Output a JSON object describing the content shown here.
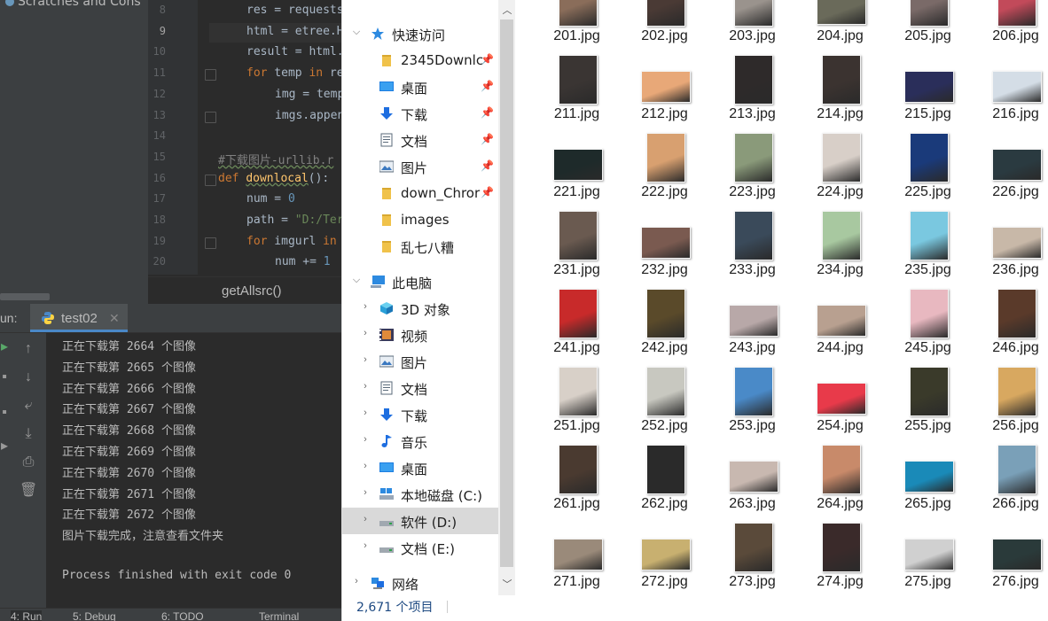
{
  "ide": {
    "project_title": "Scratches and Cons",
    "line_numbers": [
      "8",
      "9",
      "10",
      "11",
      "12",
      "13",
      "14",
      "15",
      "16",
      "17",
      "18",
      "19",
      "20"
    ],
    "current_line": "9",
    "code_lines": [
      {
        "indent": 1,
        "parts": [
          {
            "t": "res = requests",
            "c": ""
          }
        ]
      },
      {
        "indent": 1,
        "parts": [
          {
            "t": "html = ",
            "c": ""
          },
          {
            "t": "etree.H",
            "c": ""
          }
        ]
      },
      {
        "indent": 1,
        "parts": [
          {
            "t": "result = html.",
            "c": ""
          }
        ]
      },
      {
        "indent": 1,
        "parts": [
          {
            "t": "for",
            "c": "kw"
          },
          {
            "t": " temp ",
            "c": ""
          },
          {
            "t": "in",
            "c": "kw"
          },
          {
            "t": " re",
            "c": ""
          }
        ]
      },
      {
        "indent": 2,
        "parts": [
          {
            "t": "img = temp",
            "c": ""
          }
        ]
      },
      {
        "indent": 2,
        "parts": [
          {
            "t": "imgs.appen",
            "c": ""
          }
        ]
      },
      {
        "indent": 0,
        "parts": []
      },
      {
        "indent": 0,
        "parts": [
          {
            "t": "#下载图片-urllib.r",
            "c": "cm"
          }
        ]
      },
      {
        "indent": 0,
        "parts": [
          {
            "t": "def",
            "c": "kw"
          },
          {
            "t": " ",
            "c": ""
          },
          {
            "t": "downlocal",
            "c": "fn"
          },
          {
            "t": "():",
            "c": ""
          }
        ]
      },
      {
        "indent": 1,
        "parts": [
          {
            "t": "num = ",
            "c": ""
          },
          {
            "t": "0",
            "c": "num"
          }
        ]
      },
      {
        "indent": 1,
        "parts": [
          {
            "t": "path = ",
            "c": ""
          },
          {
            "t": "\"D:/Ter",
            "c": "str"
          }
        ]
      },
      {
        "indent": 1,
        "parts": [
          {
            "t": "for",
            "c": "kw"
          },
          {
            "t": " imgurl ",
            "c": ""
          },
          {
            "t": "in",
            "c": "kw"
          }
        ]
      },
      {
        "indent": 2,
        "parts": [
          {
            "t": "num += ",
            "c": ""
          },
          {
            "t": "1",
            "c": "num"
          }
        ]
      }
    ],
    "breadcrumb": "getAllsrc()",
    "run_label": "un:",
    "run_tab": "test02",
    "console_lines": [
      "正在下载第 2664 个图像",
      "正在下载第 2665 个图像",
      "正在下载第 2666 个图像",
      "正在下载第 2667 个图像",
      "正在下载第 2668 个图像",
      "正在下载第 2669 个图像",
      "正在下载第 2670 个图像",
      "正在下载第 2671 个图像",
      "正在下载第 2672 个图像",
      "图片下载完成，注意查看文件夹",
      "",
      "Process finished with exit code 0"
    ],
    "bottom_tabs": [
      "4: Run",
      "5: Debug",
      "6: TODO",
      "Terminal"
    ]
  },
  "explorer": {
    "nav_items": [
      {
        "label": "快速访问",
        "icon": "star-icon",
        "level": 0,
        "chevron": "down",
        "pinned": false
      },
      {
        "label": "2345Downlc",
        "icon": "folder-icon",
        "level": 1,
        "chevron": "",
        "pinned": true
      },
      {
        "label": "桌面",
        "icon": "desktop-icon",
        "level": 1,
        "chevron": "",
        "pinned": true
      },
      {
        "label": "下载",
        "icon": "download-icon",
        "level": 1,
        "chevron": "",
        "pinned": true
      },
      {
        "label": "文档",
        "icon": "document-icon",
        "level": 1,
        "chevron": "",
        "pinned": true
      },
      {
        "label": "图片",
        "icon": "picture-icon",
        "level": 1,
        "chevron": "",
        "pinned": true
      },
      {
        "label": "down_Chror",
        "icon": "folder-icon",
        "level": 1,
        "chevron": "",
        "pinned": true
      },
      {
        "label": "images",
        "icon": "folder-icon",
        "level": 1,
        "chevron": "",
        "pinned": false
      },
      {
        "label": "乱七八糟",
        "icon": "folder-icon",
        "level": 1,
        "chevron": "",
        "pinned": false
      },
      {
        "label": "此电脑",
        "icon": "computer-icon",
        "level": 0,
        "chevron": "down",
        "pinned": false
      },
      {
        "label": "3D 对象",
        "icon": "cube-icon",
        "level": 1,
        "chevron": "right",
        "pinned": false
      },
      {
        "label": "视频",
        "icon": "video-icon",
        "level": 1,
        "chevron": "right",
        "pinned": false
      },
      {
        "label": "图片",
        "icon": "picture-icon",
        "level": 1,
        "chevron": "right",
        "pinned": false
      },
      {
        "label": "文档",
        "icon": "document-icon",
        "level": 1,
        "chevron": "right",
        "pinned": false
      },
      {
        "label": "下载",
        "icon": "download-icon",
        "level": 1,
        "chevron": "right",
        "pinned": false
      },
      {
        "label": "音乐",
        "icon": "music-icon",
        "level": 1,
        "chevron": "right",
        "pinned": false
      },
      {
        "label": "桌面",
        "icon": "desktop-icon",
        "level": 1,
        "chevron": "right",
        "pinned": false
      },
      {
        "label": "本地磁盘 (C:)",
        "icon": "drive-c-icon",
        "level": 1,
        "chevron": "right",
        "pinned": false
      },
      {
        "label": "软件 (D:)",
        "icon": "drive-icon",
        "level": 1,
        "chevron": "right",
        "pinned": false,
        "selected": true
      },
      {
        "label": "文档 (E:)",
        "icon": "drive-icon",
        "level": 1,
        "chevron": "right",
        "pinned": false
      },
      {
        "label": "网络",
        "icon": "network-icon",
        "level": 0,
        "chevron": "right",
        "pinned": false
      }
    ],
    "status": "2,671 个项目",
    "files": [
      {
        "name": "201.jpg",
        "color": "#8a6d5a"
      },
      {
        "name": "202.jpg",
        "color": "#4a3a35"
      },
      {
        "name": "203.jpg",
        "color": "#9a938d"
      },
      {
        "name": "204.jpg",
        "color": "#6a6a5a"
      },
      {
        "name": "205.jpg",
        "color": "#7a6a68"
      },
      {
        "name": "206.jpg",
        "color": "#c24a5a"
      },
      {
        "name": "211.jpg",
        "color": "#3a3533"
      },
      {
        "name": "212.jpg",
        "color": "#e8a878"
      },
      {
        "name": "213.jpg",
        "color": "#2e2a2a"
      },
      {
        "name": "214.jpg",
        "color": "#3b3330"
      },
      {
        "name": "215.jpg",
        "color": "#2a2e5a"
      },
      {
        "name": "216.jpg",
        "color": "#d4dde6"
      },
      {
        "name": "221.jpg",
        "color": "#1e2a2a"
      },
      {
        "name": "222.jpg",
        "color": "#d8a070"
      },
      {
        "name": "223.jpg",
        "color": "#8a9a7a"
      },
      {
        "name": "224.jpg",
        "color": "#d8cfc8"
      },
      {
        "name": "225.jpg",
        "color": "#1a3a7a"
      },
      {
        "name": "226.jpg",
        "color": "#2a3a40"
      },
      {
        "name": "231.jpg",
        "color": "#6a5a50"
      },
      {
        "name": "232.jpg",
        "color": "#7a5a50"
      },
      {
        "name": "233.jpg",
        "color": "#3a4a5a"
      },
      {
        "name": "234.jpg",
        "color": "#a8c8a0"
      },
      {
        "name": "235.jpg",
        "color": "#7ac8e0"
      },
      {
        "name": "236.jpg",
        "color": "#c8b8a8"
      },
      {
        "name": "241.jpg",
        "color": "#c82a2a"
      },
      {
        "name": "242.jpg",
        "color": "#5a4a2a"
      },
      {
        "name": "243.jpg",
        "color": "#b8a8a8"
      },
      {
        "name": "244.jpg",
        "color": "#b8a090"
      },
      {
        "name": "245.jpg",
        "color": "#e8b8c0"
      },
      {
        "name": "246.jpg",
        "color": "#5a3a2a"
      },
      {
        "name": "251.jpg",
        "color": "#d8d0c8"
      },
      {
        "name": "252.jpg",
        "color": "#c8c8c0"
      },
      {
        "name": "253.jpg",
        "color": "#4a8ac8"
      },
      {
        "name": "254.jpg",
        "color": "#e83a4a"
      },
      {
        "name": "255.jpg",
        "color": "#3a3a2a"
      },
      {
        "name": "256.jpg",
        "color": "#d8a860"
      },
      {
        "name": "261.jpg",
        "color": "#4a3a30"
      },
      {
        "name": "262.jpg",
        "color": "#2a2a2a"
      },
      {
        "name": "263.jpg",
        "color": "#c8b8b0"
      },
      {
        "name": "264.jpg",
        "color": "#c88a6a"
      },
      {
        "name": "265.jpg",
        "color": "#1a8ab8"
      },
      {
        "name": "266.jpg",
        "color": "#7aa0b8"
      },
      {
        "name": "271.jpg",
        "color": "#9a8a7a"
      },
      {
        "name": "272.jpg",
        "color": "#c8b070"
      },
      {
        "name": "273.jpg",
        "color": "#5a4a3a"
      },
      {
        "name": "274.jpg",
        "color": "#3a2a2a"
      },
      {
        "name": "275.jpg",
        "color": "#d0d0d0"
      },
      {
        "name": "276.jpg",
        "color": "#2a3a3a"
      }
    ]
  }
}
